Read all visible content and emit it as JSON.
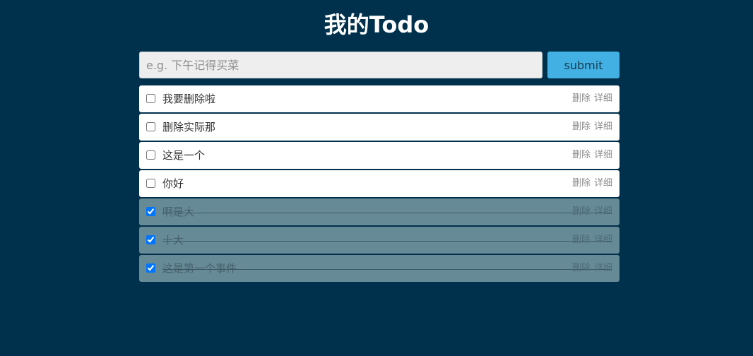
{
  "page": {
    "title": "我的Todo"
  },
  "form": {
    "input_value": "",
    "placeholder": "e.g. 下午记得买菜",
    "submit_label": "submit"
  },
  "todos": [
    {
      "text": "我要删除啦",
      "done": false,
      "delete_label": "删除",
      "detail_label": "详细"
    },
    {
      "text": "删除实际那",
      "done": false,
      "delete_label": "删除",
      "detail_label": "详细"
    },
    {
      "text": "这是一个",
      "done": false,
      "delete_label": "删除",
      "detail_label": "详细"
    },
    {
      "text": "你好",
      "done": false,
      "delete_label": "删除",
      "detail_label": "详细"
    },
    {
      "text": "啊是大",
      "done": true,
      "delete_label": "删除",
      "detail_label": "详细"
    },
    {
      "text": "十大",
      "done": true,
      "delete_label": "删除",
      "detail_label": "详细"
    },
    {
      "text": "这是第一个事件",
      "done": true,
      "delete_label": "删除",
      "detail_label": "详细"
    }
  ],
  "colors": {
    "background": "#00314c",
    "submit_button": "#42b0e3",
    "input_background": "#eeeeee",
    "item_background": "#ffffff",
    "done_item_background": "#678a97"
  }
}
